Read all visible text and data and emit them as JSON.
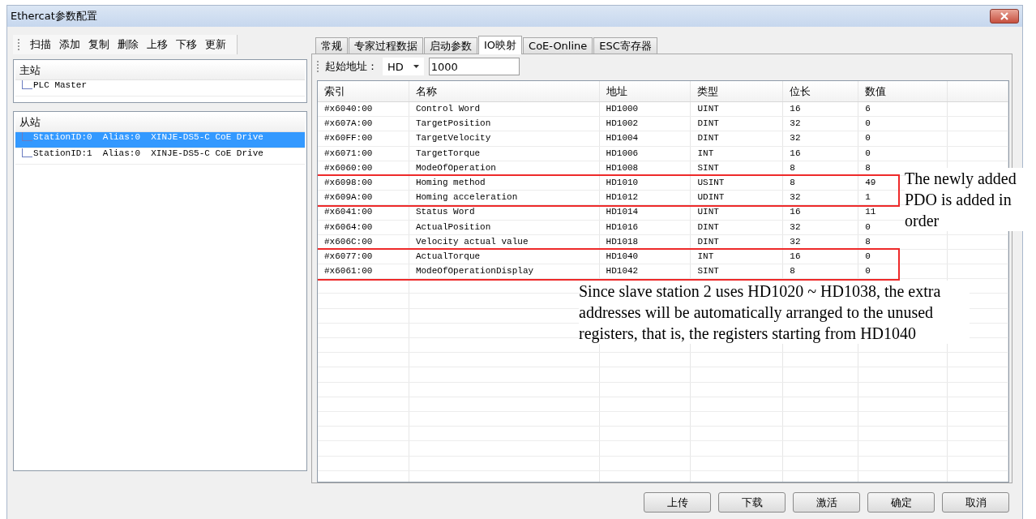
{
  "window": {
    "title": "Ethercat参数配置"
  },
  "toolbar": [
    "扫描",
    "添加",
    "复制",
    "删除",
    "上移",
    "下移",
    "更新"
  ],
  "master": {
    "header": "主站",
    "items": [
      {
        "label": "PLC Master",
        "selected": false
      }
    ]
  },
  "slaves": {
    "header": "从站",
    "items": [
      {
        "label": "StationID:0  Alias:0  XINJE-DS5-C CoE Drive",
        "selected": true
      },
      {
        "label": "StationID:1  Alias:0  XINJE-DS5-C CoE Drive",
        "selected": false
      }
    ]
  },
  "tabs": [
    {
      "label": "常规",
      "selected": false
    },
    {
      "label": "专家过程数据",
      "selected": false
    },
    {
      "label": "启动参数",
      "selected": false
    },
    {
      "label": "IO映射",
      "selected": true
    },
    {
      "label": "CoE-Online",
      "selected": false
    },
    {
      "label": "ESC寄存器",
      "selected": false
    }
  ],
  "address_bar": {
    "label": "起始地址：",
    "area": "HD",
    "start": "1000"
  },
  "table": {
    "columns": [
      "索引",
      "名称",
      "地址",
      "类型",
      "位长",
      "数值"
    ],
    "rows": [
      {
        "cells": [
          "#x6040:00",
          "Control Word",
          "HD1000",
          "UINT",
          "16",
          "6"
        ],
        "highlighted": false
      },
      {
        "cells": [
          "#x607A:00",
          "TargetPosition",
          "HD1002",
          "DINT",
          "32",
          "0"
        ],
        "highlighted": false
      },
      {
        "cells": [
          "#x60FF:00",
          "TargetVelocity",
          "HD1004",
          "DINT",
          "32",
          "0"
        ],
        "highlighted": false
      },
      {
        "cells": [
          "#x6071:00",
          "TargetTorque",
          "HD1006",
          "INT",
          "16",
          "0"
        ],
        "highlighted": false
      },
      {
        "cells": [
          "#x6060:00",
          "ModeOfOperation",
          "HD1008",
          "SINT",
          "8",
          "8"
        ],
        "highlighted": false
      },
      {
        "cells": [
          "#x6098:00",
          "Homing method",
          "HD1010",
          "USINT",
          "8",
          "49"
        ],
        "highlighted": true
      },
      {
        "cells": [
          "#x609A:00",
          "Homing acceleration",
          "HD1012",
          "UDINT",
          "32",
          "1"
        ],
        "highlighted": true
      },
      {
        "cells": [
          "#x6041:00",
          "Status Word",
          "HD1014",
          "UINT",
          "16",
          "11"
        ],
        "highlighted": false
      },
      {
        "cells": [
          "#x6064:00",
          "ActualPosition",
          "HD1016",
          "DINT",
          "32",
          "0"
        ],
        "highlighted": false
      },
      {
        "cells": [
          "#x606C:00",
          "Velocity actual value",
          "HD1018",
          "DINT",
          "32",
          "8"
        ],
        "highlighted": false
      },
      {
        "cells": [
          "#x6077:00",
          "ActualTorque",
          "HD1040",
          "INT",
          "16",
          "0"
        ],
        "highlighted": true
      },
      {
        "cells": [
          "#x6061:00",
          "ModeOfOperationDisplay",
          "HD1042",
          "SINT",
          "8",
          "0"
        ],
        "highlighted": true
      }
    ]
  },
  "buttons": [
    "上传",
    "下载",
    "激活",
    "确定",
    "取消"
  ],
  "annotations": [
    {
      "kind": "side",
      "text": "The newly added PDO is added in order"
    },
    {
      "kind": "below",
      "text": "Since slave station 2 uses HD1020 ~ HD1038, the extra addresses will be automatically arranged to the unused registers, that is, the registers starting from HD1040"
    }
  ]
}
